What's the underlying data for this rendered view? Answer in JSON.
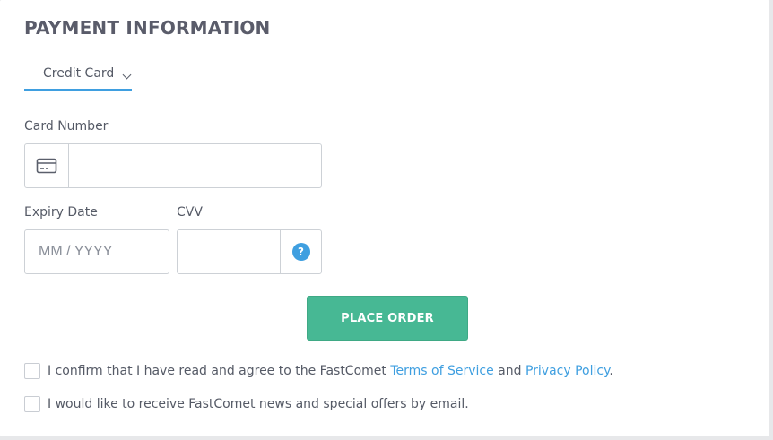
{
  "payment": {
    "title": "PAYMENT INFORMATION",
    "method_selected": "Credit Card",
    "card_number": {
      "label": "Card Number",
      "value": "",
      "placeholder": ""
    },
    "expiry": {
      "label": "Expiry Date",
      "value": "",
      "placeholder": "MM / YYYY"
    },
    "cvv": {
      "label": "CVV",
      "value": "",
      "help_symbol": "?"
    },
    "place_order_label": "PLACE ORDER"
  },
  "agreements": {
    "terms": {
      "text_before": "I confirm that I have read and agree to the FastComet ",
      "terms_link": "Terms of Service",
      "text_and": " and ",
      "privacy_link": "Privacy Policy",
      "text_after": "."
    },
    "news": {
      "text": "I would like to receive FastComet news and special offers by email."
    }
  },
  "colors": {
    "accent": "#3f9fe0",
    "button": "#47b894",
    "title": "#5a5c6a",
    "text": "#555a66",
    "border": "#cdd1d6"
  },
  "icons": {
    "card": "credit-card-icon",
    "dropdown": "chevron-down-icon",
    "help": "question-circle-icon"
  }
}
